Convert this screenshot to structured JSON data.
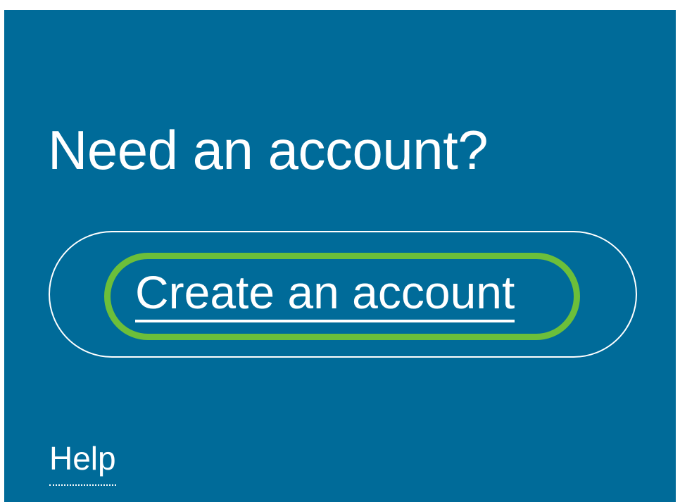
{
  "signup_panel": {
    "heading": "Need an account?",
    "create_account_label": "Create an account",
    "help_label": "Help"
  },
  "colors": {
    "panel_background": "#006b99",
    "text": "#ffffff",
    "highlight_ring": "#6cbf3a"
  }
}
